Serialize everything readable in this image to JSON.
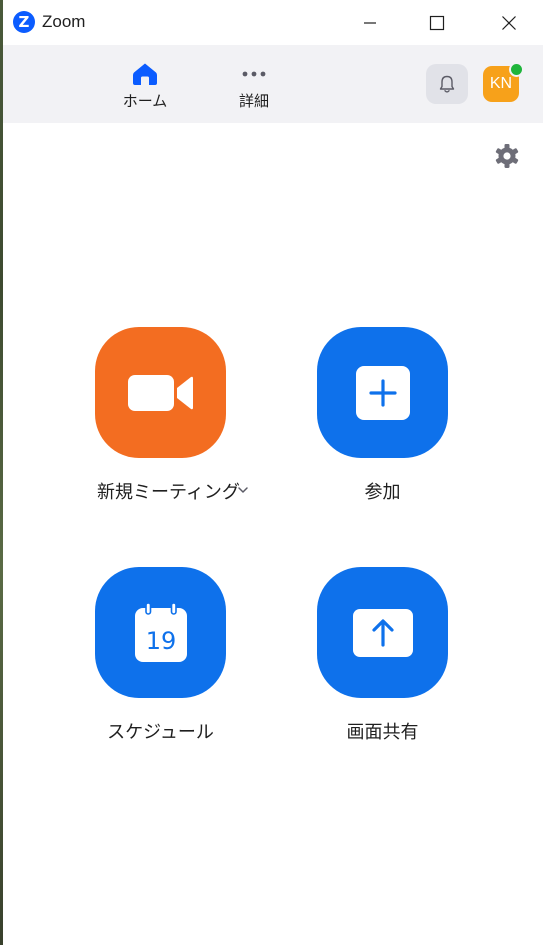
{
  "window": {
    "title": "Zoom",
    "logo_letter": "Z"
  },
  "nav": {
    "home_label": "ホーム",
    "more_label": "詳細"
  },
  "user": {
    "initials": "KN",
    "status": "online"
  },
  "actions": {
    "new_meeting": {
      "label": "新規ミーティング",
      "icon": "video-camera-icon"
    },
    "join": {
      "label": "参加",
      "icon": "plus-icon"
    },
    "schedule": {
      "label": "スケジュール",
      "icon": "calendar-icon",
      "calendar_day": "19"
    },
    "share_screen": {
      "label": "画面共有",
      "icon": "share-arrow-icon"
    }
  },
  "colors": {
    "brand_blue": "#0b5cff",
    "tile_blue": "#0e71eb",
    "tile_orange": "#f36d21",
    "avatar_bg": "#f7a11a",
    "status_online": "#1fb53b",
    "nav_bg": "#f2f2f5"
  }
}
